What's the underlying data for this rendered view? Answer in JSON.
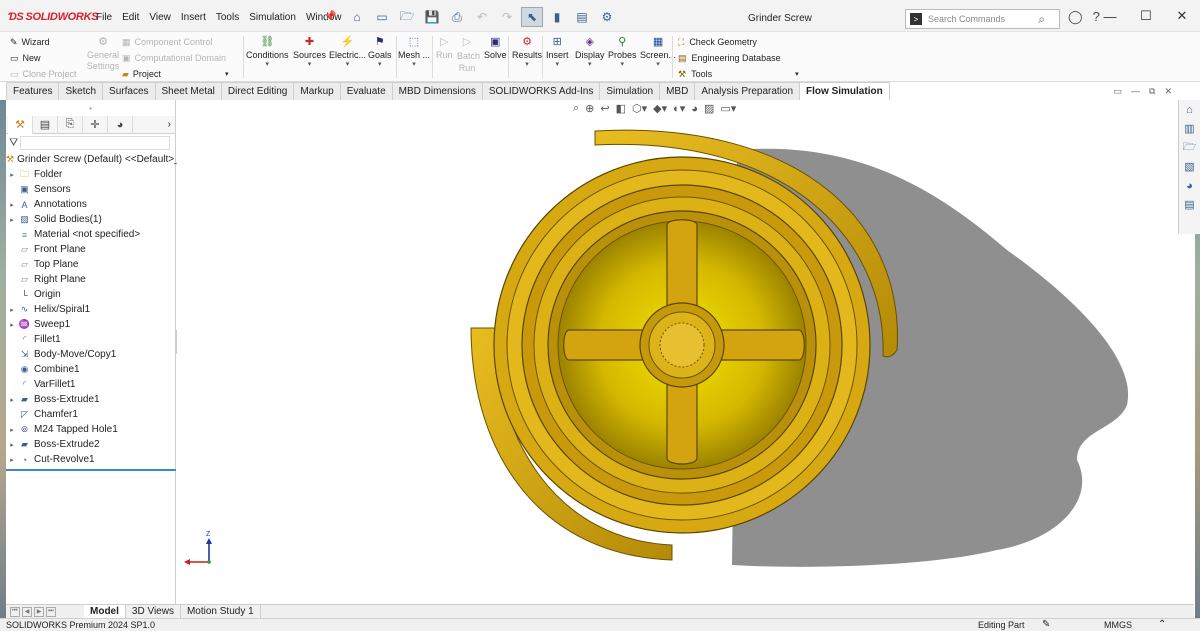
{
  "app": {
    "logo_text": "SOLIDWORKS",
    "document_title": "Grinder Screw"
  },
  "menu": [
    "File",
    "Edit",
    "View",
    "Insert",
    "Tools",
    "Simulation",
    "Window"
  ],
  "search": {
    "placeholder": "Search Commands"
  },
  "command_manager": {
    "left_items": [
      {
        "label": "Wizard",
        "enabled": true
      },
      {
        "label": "New",
        "enabled": true
      },
      {
        "label": "Clone Project",
        "enabled": false
      }
    ],
    "general_settings": "General Settings",
    "component_control": "Component Control",
    "computational_domain": "Computational Domain",
    "project": "Project",
    "buttons": [
      {
        "label": "Conditions",
        "icon": "conditions-icon",
        "enabled": true
      },
      {
        "label": "Sources",
        "icon": "sources-icon",
        "enabled": true
      },
      {
        "label": "Electric...",
        "icon": "electric-icon",
        "enabled": true
      },
      {
        "label": "Goals",
        "icon": "goals-icon",
        "enabled": true
      },
      {
        "label": "Mesh ...",
        "icon": "mesh-icon",
        "enabled": true
      },
      {
        "label": "Run",
        "icon": "run-icon",
        "enabled": false
      },
      {
        "label": "Batch Run",
        "icon": "batch-run-icon",
        "enabled": false
      },
      {
        "label": "Solve",
        "icon": "solve-icon",
        "enabled": true
      },
      {
        "label": "Results",
        "icon": "results-icon",
        "enabled": true
      },
      {
        "label": "Insert",
        "icon": "insert-icon",
        "enabled": true
      },
      {
        "label": "Display",
        "icon": "display-icon",
        "enabled": true
      },
      {
        "label": "Probes",
        "icon": "probes-icon",
        "enabled": true
      },
      {
        "label": "Screen...",
        "icon": "screen-icon",
        "enabled": true
      }
    ],
    "right_items": [
      {
        "label": "Check Geometry",
        "icon": "check-geometry-icon"
      },
      {
        "label": "Engineering Database",
        "icon": "database-icon"
      },
      {
        "label": "Tools",
        "icon": "tools-icon"
      }
    ]
  },
  "tabs": [
    {
      "label": "Features",
      "active": false
    },
    {
      "label": "Sketch",
      "active": false
    },
    {
      "label": "Surfaces",
      "active": false
    },
    {
      "label": "Sheet Metal",
      "active": false
    },
    {
      "label": "Direct Editing",
      "active": false
    },
    {
      "label": "Markup",
      "active": false
    },
    {
      "label": "Evaluate",
      "active": false
    },
    {
      "label": "MBD Dimensions",
      "active": false
    },
    {
      "label": "SOLIDWORKS Add-Ins",
      "active": false
    },
    {
      "label": "Simulation",
      "active": false
    },
    {
      "label": "MBD",
      "active": false
    },
    {
      "label": "Analysis Preparation",
      "active": false
    },
    {
      "label": "Flow Simulation",
      "active": true
    }
  ],
  "feature_tree": {
    "root": "Grinder Screw (Default) <<Default>_",
    "items": [
      {
        "label": "Folder",
        "expandable": true,
        "icon": "folder-icon"
      },
      {
        "label": "Sensors",
        "expandable": false,
        "icon": "sensors-icon"
      },
      {
        "label": "Annotations",
        "expandable": true,
        "icon": "annotations-icon"
      },
      {
        "label": "Solid Bodies(1)",
        "expandable": true,
        "icon": "solid-bodies-icon"
      },
      {
        "label": "Material <not specified>",
        "expandable": false,
        "icon": "material-icon"
      },
      {
        "label": "Front Plane",
        "expandable": false,
        "icon": "plane-icon"
      },
      {
        "label": "Top Plane",
        "expandable": false,
        "icon": "plane-icon"
      },
      {
        "label": "Right Plane",
        "expandable": false,
        "icon": "plane-icon"
      },
      {
        "label": "Origin",
        "expandable": false,
        "icon": "origin-icon"
      },
      {
        "label": "Helix/Spiral1",
        "expandable": true,
        "icon": "helix-icon"
      },
      {
        "label": "Sweep1",
        "expandable": true,
        "icon": "sweep-icon"
      },
      {
        "label": "Fillet1",
        "expandable": false,
        "icon": "fillet-icon"
      },
      {
        "label": "Body-Move/Copy1",
        "expandable": false,
        "icon": "move-copy-icon"
      },
      {
        "label": "Combine1",
        "expandable": false,
        "icon": "combine-icon"
      },
      {
        "label": "VarFillet1",
        "expandable": false,
        "icon": "varfillet-icon"
      },
      {
        "label": "Boss-Extrude1",
        "expandable": true,
        "icon": "extrude-icon"
      },
      {
        "label": "Chamfer1",
        "expandable": false,
        "icon": "chamfer-icon"
      },
      {
        "label": "M24 Tapped Hole1",
        "expandable": true,
        "icon": "hole-icon"
      },
      {
        "label": "Boss-Extrude2",
        "expandable": true,
        "icon": "extrude-icon"
      },
      {
        "label": "Cut-Revolve1",
        "expandable": true,
        "icon": "revolve-icon"
      }
    ]
  },
  "bottom_tabs": [
    {
      "label": "Model",
      "active": true
    },
    {
      "label": "3D Views",
      "active": false
    },
    {
      "label": "Motion Study 1",
      "active": false
    }
  ],
  "status": {
    "product": "SOLIDWORKS Premium 2024 SP1.0",
    "mode": "Editing Part",
    "units": "MMGS"
  },
  "triad": {
    "z_label": "Z"
  },
  "colors": {
    "part_gold": "#d9ad10",
    "part_dark": "#8a6a00",
    "shadow": "#8a8a8a",
    "accent": "#3a8ad0"
  }
}
